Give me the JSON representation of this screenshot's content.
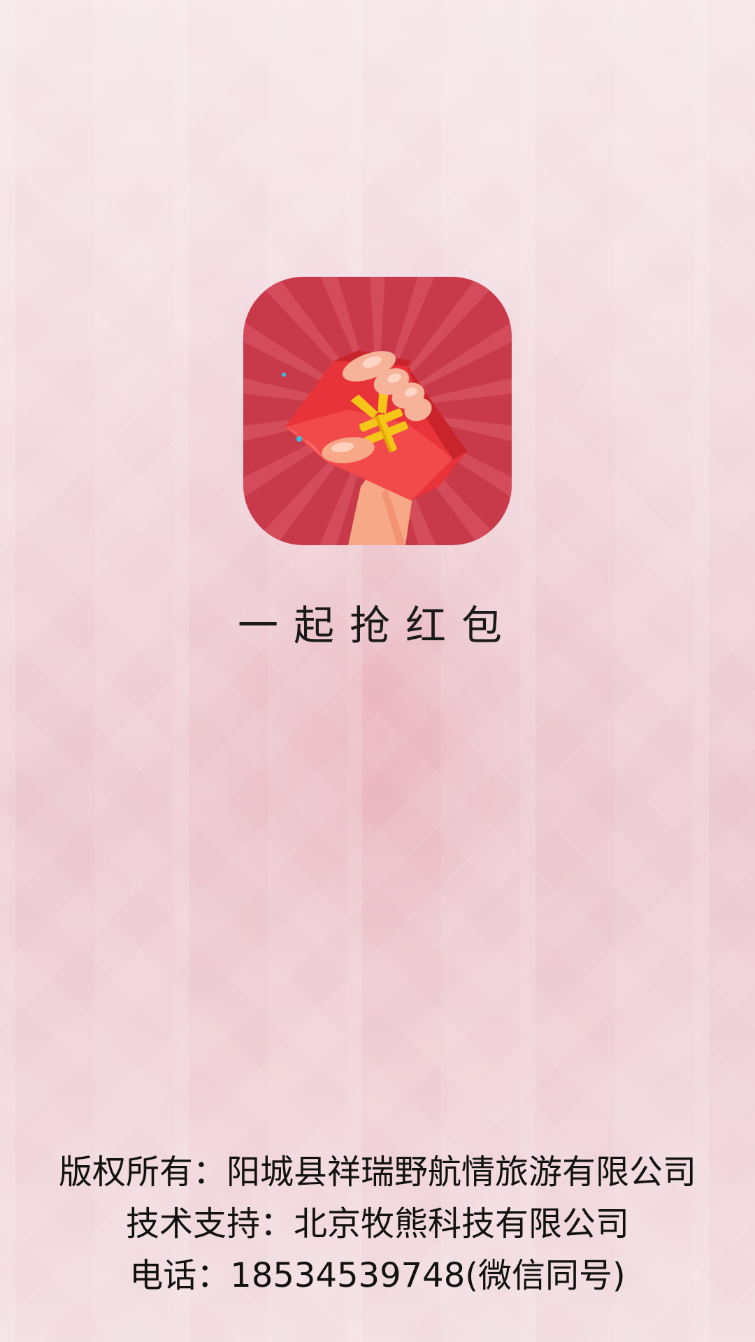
{
  "splash": {
    "icon": "red-envelope-hand-icon",
    "app_name": "一起抢红包",
    "footer": {
      "copyright": "版权所有：阳城县祥瑞野航情旅游有限公司",
      "tech_support": "技术支持：北京牧熊科技有限公司",
      "phone": "电话：18534539748(微信同号)"
    }
  },
  "colors": {
    "icon_bg": "#c8394a",
    "envelope": "#e8333a",
    "yuan_symbol": "#f5c518",
    "hand": "#f7a886"
  }
}
